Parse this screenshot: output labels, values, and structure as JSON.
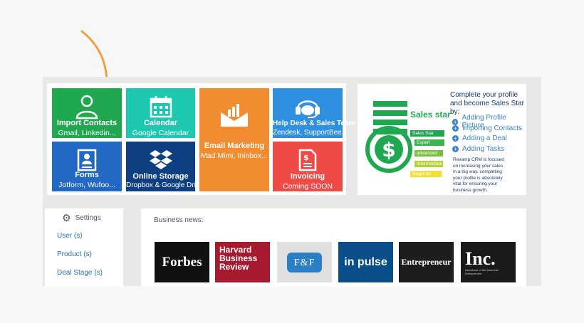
{
  "tiles": [
    {
      "title": "Import Contacts",
      "subtitle": "Gmail, Linkedin...",
      "icon": "contact-icon",
      "color": "#1fa84f"
    },
    {
      "title": "Calendar",
      "subtitle": "Google Calendar",
      "icon": "calendar-icon",
      "color": "#1ec8b0"
    },
    {
      "title": "Email Marketing",
      "subtitle": "Mad Mimi, Ininbox...",
      "icon": "email-chart-icon",
      "color": "#f28c30"
    },
    {
      "title": "Help Desk & Sales Team",
      "subtitle": "Zendesk, SupportBee...",
      "icon": "headset-icon",
      "color": "#2f8fe0"
    },
    {
      "title": "Forms",
      "subtitle": "Jotform, Wufoo...",
      "icon": "form-icon",
      "color": "#2169c4"
    },
    {
      "title": "Online Storage",
      "subtitle": "Dropbox & Google Drive",
      "icon": "dropbox-icon",
      "color": "#0e3f80"
    },
    {
      "title": "Invoicing",
      "subtitle": "Coming SOON",
      "icon": "invoice-icon",
      "color": "#ee4a46"
    }
  ],
  "promo": {
    "heading_line1": "Complete your profile",
    "heading_line2": "and become Sales Star by:",
    "sales_star_label": "Sales star",
    "levels": [
      "Sales Star",
      "Expert",
      "advanced",
      "Intermediate",
      "Beginner"
    ],
    "level_colors": [
      "#1fa84f",
      "#3cb54a",
      "#7cc242",
      "#b5d334",
      "#f2e030"
    ],
    "items": [
      "Adding Profile Picture",
      "Importing Contacts",
      "Adding a Deal",
      "Adding Tasks"
    ],
    "footer": [
      "Revamp CRM is focused",
      "on increasing your sales",
      "in a big way. completing",
      "your profile is absolutely",
      "vital for ensuring your",
      "business growth."
    ]
  },
  "settings": {
    "title": "Settings",
    "items": [
      "User (s)",
      "Product (s)",
      "Deal Stage (s)"
    ]
  },
  "news": {
    "title": "Business news:",
    "logos": [
      {
        "text": "Forbes",
        "bg": "#111111"
      },
      {
        "text": "Harvard Business Review",
        "bg": "#a6192e"
      },
      {
        "text": "F&F",
        "bg": "#e0e0e0"
      },
      {
        "text": "in pulse",
        "bg": "#0b4f8a"
      },
      {
        "text": "Entrepreneur",
        "bg": "#1d1d1d"
      },
      {
        "text": "Inc.",
        "bg": "#1a1a1a"
      },
      {
        "text": "Handbook of the American Entrepreneur",
        "bg": "#1a1a1a"
      }
    ]
  },
  "accent_arrow_color": "#f0a040"
}
